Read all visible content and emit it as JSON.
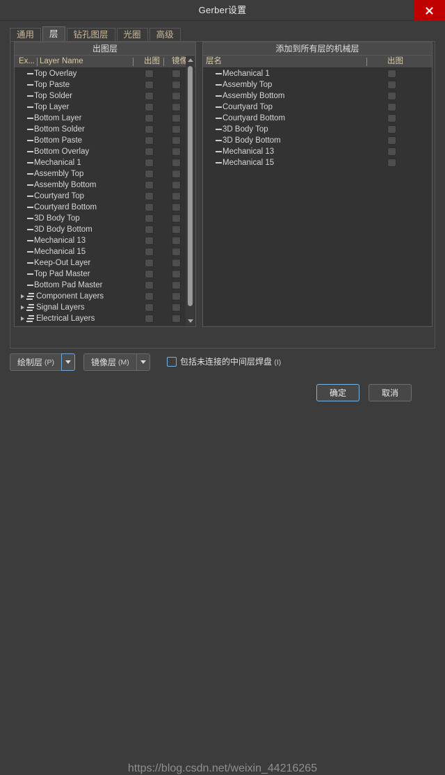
{
  "window": {
    "title": "Gerber设置",
    "close_label": "✕"
  },
  "tabs": [
    {
      "label": "通用",
      "active": false
    },
    {
      "label": "层",
      "active": true
    },
    {
      "label": "钻孔图层",
      "active": false
    },
    {
      "label": "光圈",
      "active": false
    },
    {
      "label": "高级",
      "active": false
    }
  ],
  "left_panel": {
    "title": "出图层",
    "columns": [
      "Ex...",
      "Layer Name",
      "出图",
      "镜像"
    ],
    "rows": [
      {
        "label": "Top Overlay",
        "type": "layer",
        "plot": false,
        "mirror": false
      },
      {
        "label": "Top Paste",
        "type": "layer",
        "plot": false,
        "mirror": false
      },
      {
        "label": "Top Solder",
        "type": "layer",
        "plot": false,
        "mirror": false
      },
      {
        "label": "Top Layer",
        "type": "layer",
        "plot": false,
        "mirror": false
      },
      {
        "label": "Bottom Layer",
        "type": "layer",
        "plot": false,
        "mirror": false
      },
      {
        "label": "Bottom Solder",
        "type": "layer",
        "plot": false,
        "mirror": false
      },
      {
        "label": "Bottom Paste",
        "type": "layer",
        "plot": false,
        "mirror": false
      },
      {
        "label": "Bottom Overlay",
        "type": "layer",
        "plot": false,
        "mirror": false
      },
      {
        "label": "Mechanical 1",
        "type": "layer",
        "plot": false,
        "mirror": false
      },
      {
        "label": "Assembly Top",
        "type": "layer",
        "plot": false,
        "mirror": false
      },
      {
        "label": "Assembly Bottom",
        "type": "layer",
        "plot": false,
        "mirror": false
      },
      {
        "label": "Courtyard Top",
        "type": "layer",
        "plot": false,
        "mirror": false
      },
      {
        "label": "Courtyard Bottom",
        "type": "layer",
        "plot": false,
        "mirror": false
      },
      {
        "label": "3D Body Top",
        "type": "layer",
        "plot": false,
        "mirror": false
      },
      {
        "label": "3D Body Bottom",
        "type": "layer",
        "plot": false,
        "mirror": false
      },
      {
        "label": "Mechanical 13",
        "type": "layer",
        "plot": false,
        "mirror": false
      },
      {
        "label": "Mechanical 15",
        "type": "layer",
        "plot": false,
        "mirror": false
      },
      {
        "label": "Keep-Out Layer",
        "type": "layer",
        "plot": false,
        "mirror": false
      },
      {
        "label": "Top Pad Master",
        "type": "layer",
        "plot": false,
        "mirror": false
      },
      {
        "label": "Bottom Pad Master",
        "type": "layer",
        "plot": false,
        "mirror": false
      },
      {
        "label": "Component Layers",
        "type": "group",
        "plot": false,
        "mirror": false
      },
      {
        "label": "Signal Layers",
        "type": "group",
        "plot": false,
        "mirror": false
      },
      {
        "label": "Electrical Layers",
        "type": "group",
        "plot": false,
        "mirror": false
      }
    ]
  },
  "right_panel": {
    "title": "添加到所有层的机械层",
    "columns": [
      "层名",
      "出图"
    ],
    "rows": [
      {
        "label": "Mechanical 1",
        "type": "layer",
        "plot": false
      },
      {
        "label": "Assembly Top",
        "type": "layer",
        "plot": false
      },
      {
        "label": "Assembly Bottom",
        "type": "layer",
        "plot": false
      },
      {
        "label": "Courtyard Top",
        "type": "layer",
        "plot": false
      },
      {
        "label": "Courtyard Bottom",
        "type": "layer",
        "plot": false
      },
      {
        "label": "3D Body Top",
        "type": "layer",
        "plot": false
      },
      {
        "label": "3D Body Bottom",
        "type": "layer",
        "plot": false
      },
      {
        "label": "Mechanical 13",
        "type": "layer",
        "plot": false
      },
      {
        "label": "Mechanical 15",
        "type": "layer",
        "plot": false
      }
    ]
  },
  "bottom": {
    "plot_layers_button": "绘制层",
    "plot_layers_accel": "(P)",
    "mirror_layers_button": "镜像层",
    "mirror_layers_accel": "(M)",
    "include_unconnected_label": "包括未连接的中间层焊盘",
    "include_unconnected_accel": "(I)",
    "include_unconnected_checked": false
  },
  "footer": {
    "ok_label": "确定",
    "cancel_label": "取消",
    "watermark": "https://blog.csdn.net/weixin_44216265"
  },
  "colors": {
    "window_bg": "#3c3c3c",
    "panel_bg": "#333333",
    "header_bg": "#4a4a4a",
    "close_red": "#c10000",
    "accent_blue": "#7ab3e0",
    "tab_text": "#c8b89a"
  }
}
